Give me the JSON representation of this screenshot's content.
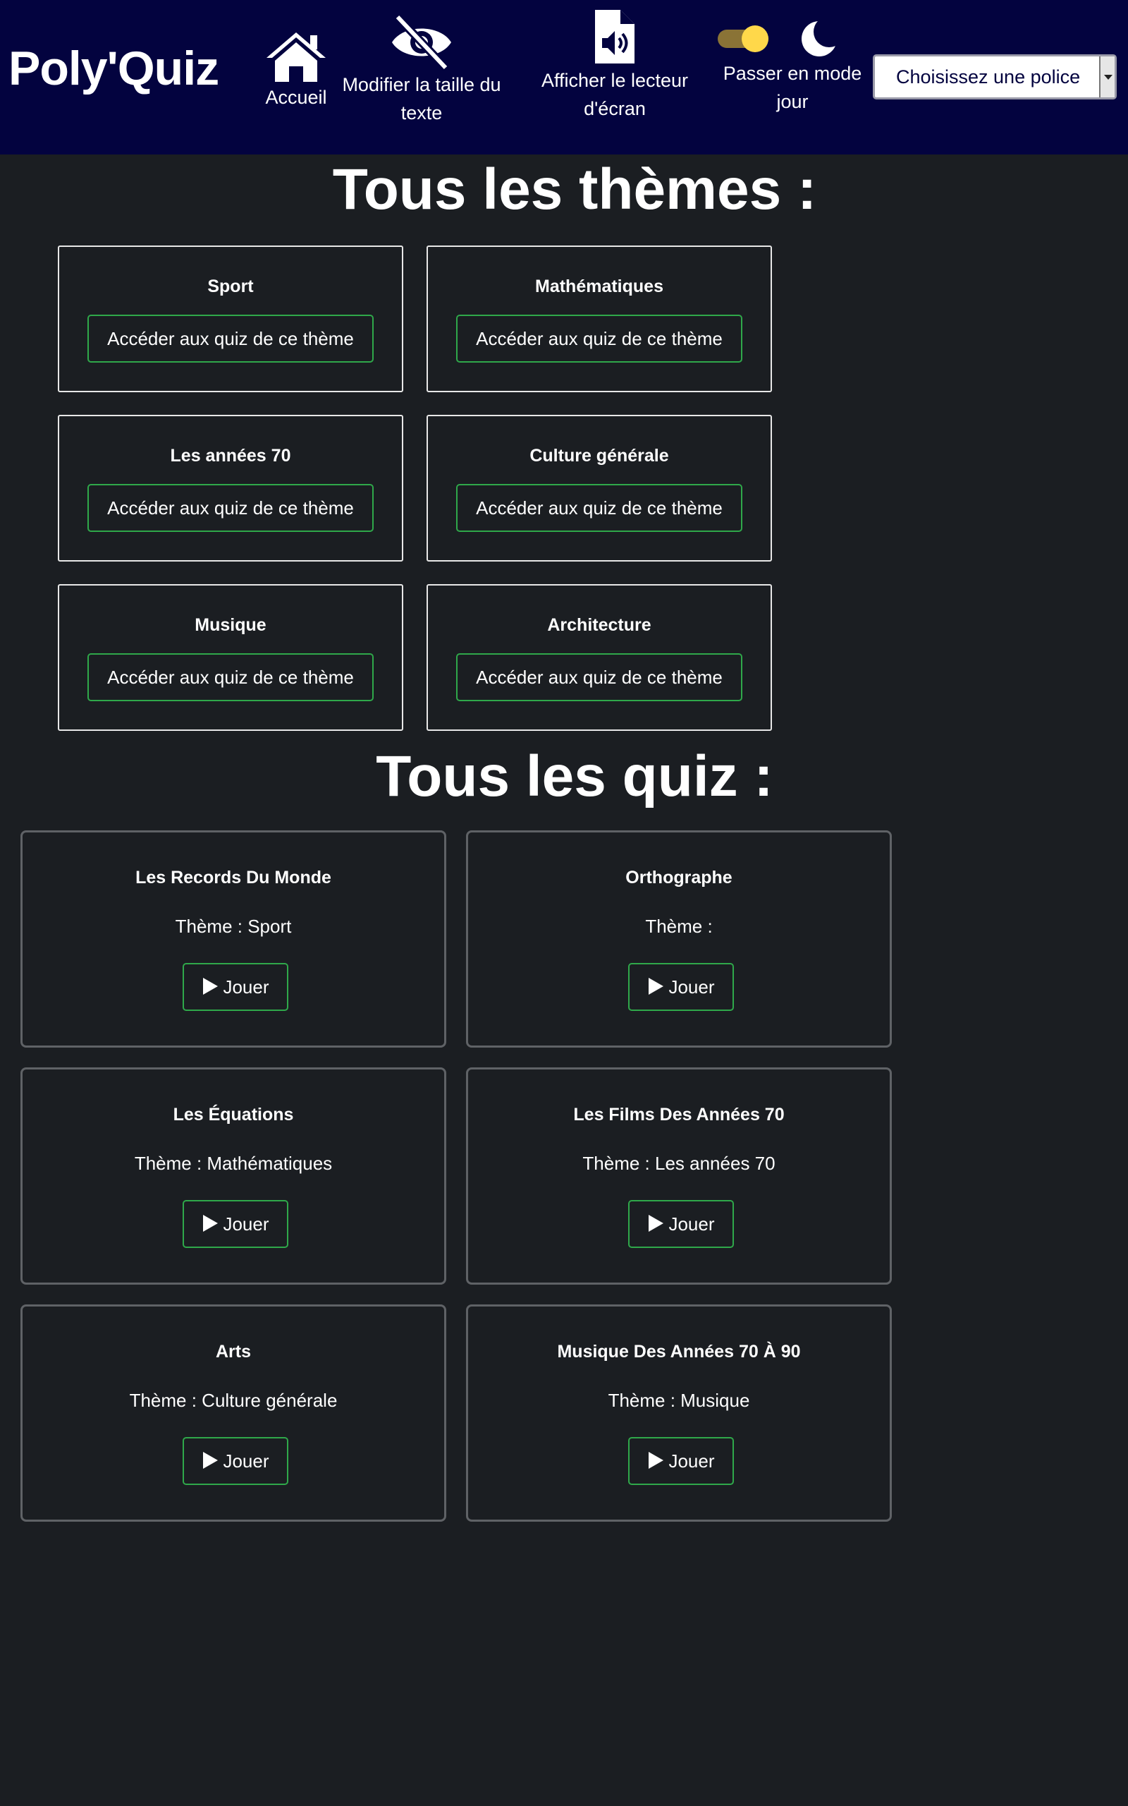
{
  "header": {
    "brand": "Poly'Quiz",
    "nav": {
      "home": "Accueil",
      "text_size": "Modifier la taille du texte",
      "screen_reader": "Afficher le lecteur d'écran",
      "day_mode": "Passer en mode jour"
    },
    "font_select": {
      "selected": "Choisissez une police"
    },
    "icons": [
      "home-icon",
      "eye-slash-icon",
      "audio-file-icon",
      "toggle-switch",
      "moon-icon"
    ]
  },
  "themes": {
    "title": "Tous les thèmes :",
    "button_label": "Accéder aux quiz de ce thème",
    "items": [
      {
        "name": "Sport"
      },
      {
        "name": "Mathématiques"
      },
      {
        "name": "Les années 70"
      },
      {
        "name": "Culture générale"
      },
      {
        "name": "Musique"
      },
      {
        "name": "Architecture"
      }
    ]
  },
  "quizzes": {
    "title": "Tous les quiz :",
    "play_label": "Jouer",
    "items": [
      {
        "name": "Les Records Du Monde",
        "theme": "Thème : Sport"
      },
      {
        "name": "Orthographe",
        "theme": "Thème :"
      },
      {
        "name": "Les Équations",
        "theme": "Thème : Mathématiques"
      },
      {
        "name": "Les Films Des Années 70",
        "theme": "Thème : Les années 70"
      },
      {
        "name": "Arts",
        "theme": "Thème : Culture générale"
      },
      {
        "name": "Musique Des Années 70 À 90",
        "theme": "Thème : Musique"
      }
    ]
  },
  "colors": {
    "header_bg": "#03033f",
    "page_bg": "#1b1e22",
    "button_border": "#2fa84a",
    "toggle_knob": "#ffd84a"
  }
}
